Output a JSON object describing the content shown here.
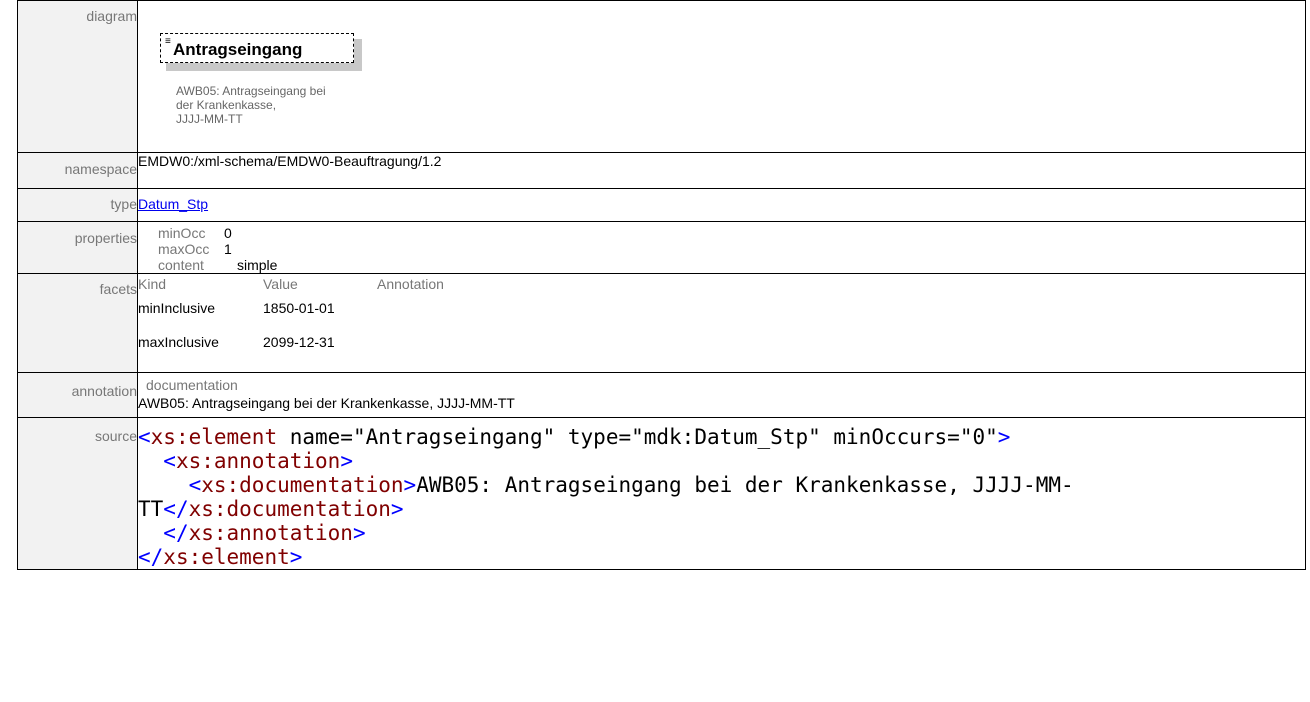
{
  "diagram": {
    "label": "diagram",
    "element_name": "Antragseingang",
    "doc_lines": [
      "AWB05: Antragseingang bei",
      "der Krankenkasse,",
      "JJJJ-MM-TT"
    ]
  },
  "namespace": {
    "label": "namespace",
    "value": "EMDW0:/xml-schema/EMDW0-Beauftragung/1.2"
  },
  "type": {
    "label": "type",
    "value": "Datum_Stp"
  },
  "properties": {
    "label": "properties",
    "rows": [
      {
        "key": "minOcc",
        "value": "0"
      },
      {
        "key": "maxOcc",
        "value": "1"
      },
      {
        "key": "content",
        "value": "simple"
      }
    ]
  },
  "facets": {
    "label": "facets",
    "headers": [
      "Kind",
      "Value",
      "Annotation"
    ],
    "rows": [
      {
        "kind": "minInclusive",
        "value": "1850-01-01",
        "annotation": ""
      },
      {
        "kind": "maxInclusive",
        "value": "2099-12-31",
        "annotation": ""
      }
    ]
  },
  "annotation": {
    "label": "annotation",
    "key": "documentation",
    "value": "AWB05: Antragseingang bei der Krankenkasse, JJJJ-MM-TT"
  },
  "source": {
    "label": "source",
    "lines": [
      "<xs:element name=\"Antragseingang\" type=\"mdk:Datum_Stp\" minOccurs=\"0\">",
      "  <xs:annotation>",
      "    <xs:documentation>AWB05: Antragseingang bei der Krankenkasse, JJJJ-MM-",
      "TT</xs:documentation>",
      "  </xs:annotation>",
      "</xs:element>"
    ]
  }
}
